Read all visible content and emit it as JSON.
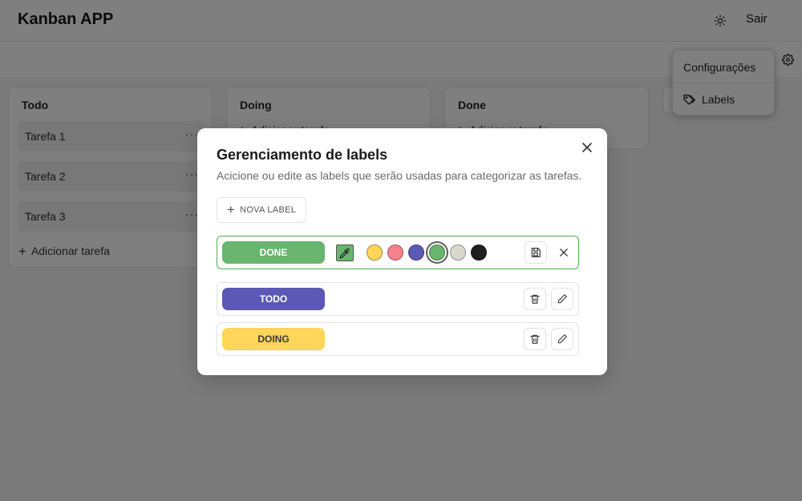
{
  "header": {
    "title": "Kanban APP",
    "theme_icon": "sun-icon",
    "logout_label": "Sair"
  },
  "toolbar": {
    "settings_icon": "gear-icon"
  },
  "dropdown": {
    "title": "Configurações",
    "items": [
      {
        "label": "Labels",
        "icon": "tag-icon"
      }
    ]
  },
  "columns": [
    {
      "title": "Todo",
      "tasks": [
        "Tarefa 1",
        "Tarefa 2",
        "Tarefa 3"
      ],
      "add_label": "Adicionar tarefa"
    },
    {
      "title": "Doing",
      "tasks": [],
      "add_label": "Adicionar tarefa"
    },
    {
      "title": "Done",
      "tasks": [],
      "add_label": "Adicionar tarefa"
    }
  ],
  "modal": {
    "title": "Gerenciamento de labels",
    "description": "Acicione ou edite as labels que serão usadas para categorizar as tarefas.",
    "new_label_button": "NOVA LABEL",
    "labels": [
      {
        "name": "DONE",
        "color": "#6ab56e",
        "text_color": "#ffffff",
        "editing": true
      },
      {
        "name": "TODO",
        "color": "#5c58b5",
        "text_color": "#ffffff",
        "editing": false
      },
      {
        "name": "DOING",
        "color": "#ffd55a",
        "text_color": "#3a3a3a",
        "editing": false
      }
    ],
    "palette": [
      {
        "color": "#ffd55a",
        "selected": false
      },
      {
        "color": "#f6828c",
        "selected": false
      },
      {
        "color": "#5c58b5",
        "selected": false
      },
      {
        "color": "#6ab56e",
        "selected": true
      },
      {
        "color": "#d8d8cf",
        "selected": false
      },
      {
        "color": "#1f1f1f",
        "selected": false
      }
    ]
  }
}
